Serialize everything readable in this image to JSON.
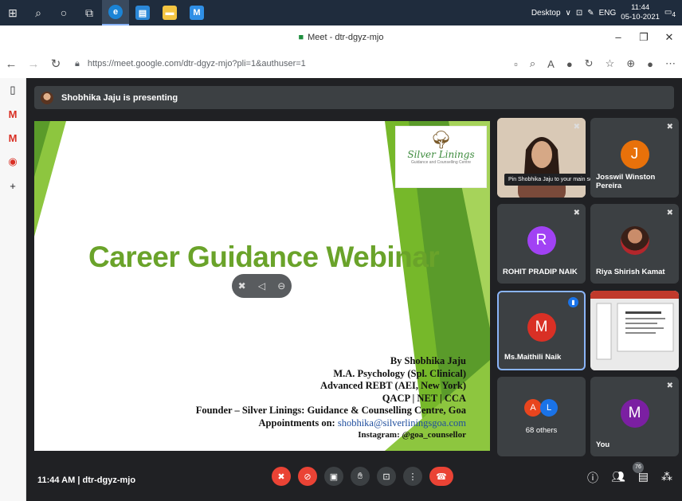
{
  "taskbar": {
    "search_label": "Desktop",
    "lang": "ENG",
    "time": "11:44",
    "date": "05-10-2021",
    "notif": "4"
  },
  "window": {
    "title": "Meet - dtr-dgyz-mjo"
  },
  "address": {
    "url": "https://meet.google.com/dtr-dgyz-mjo?pli=1&authuser=1"
  },
  "meet": {
    "presenting": "Shobhika Jaju is presenting",
    "slide": {
      "title": "Career Guidance Webinar",
      "logo_name": "Silver Linings",
      "logo_sub": "Guidance and Counselling Centre",
      "lines": [
        "By Shobhika Jaju",
        "M.A. Psychology (Spl. Clinical)",
        "Advanced REBT (AEI, New York)",
        "QACP | NET | CCA",
        "Founder – Silver Linings: Guidance & Counselling Centre, Goa"
      ],
      "appt_label": "Appointments on: ",
      "appt_email": "shobhika@silverliningsgoa.com",
      "insta": "Instagram: @goa_counsellor"
    },
    "tooltip": "Pin Shobhika Jaju to your main screen.",
    "participants": [
      {
        "name": "Josswil Winston Pereira",
        "initial": "J",
        "color": "#e8710a"
      },
      {
        "name": "ROHIT PRADIP NAIK",
        "initial": "R",
        "color": "#a142f4"
      },
      {
        "name": "Riya Shirish Kamat",
        "initial": "",
        "color": "#5a3420"
      },
      {
        "name": "Ms.Maithili Naik",
        "initial": "M",
        "color": "#d93025"
      },
      {
        "name": "68 others",
        "initial": "",
        "color": ""
      },
      {
        "name": "You",
        "initial": "M",
        "color": "#7b1fa2"
      }
    ],
    "others_a": "A",
    "others_l": "L",
    "meeting_info": "11:44 AM  |  dtr-dgyz-mjo",
    "people_count": "76"
  }
}
